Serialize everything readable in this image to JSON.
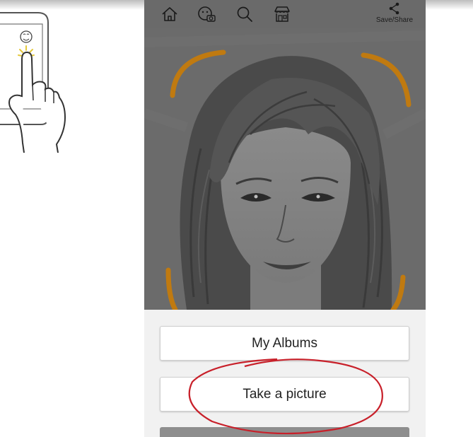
{
  "toolbar": {
    "icons": [
      "home-icon",
      "face-camera-icon",
      "search-icon",
      "store-icon",
      "share-icon"
    ],
    "save_share_label": "Save/Share"
  },
  "main": {
    "my_albums_label": "My Albums",
    "take_picture_label": "Take a picture"
  },
  "colors": {
    "toolbar_bg": "#6a6a6a",
    "photo_bg": "#6b6b6b",
    "face_frame": "#c07a10",
    "annotation_circle": "#c8202a",
    "screen_bg": "#f1f1f1"
  }
}
